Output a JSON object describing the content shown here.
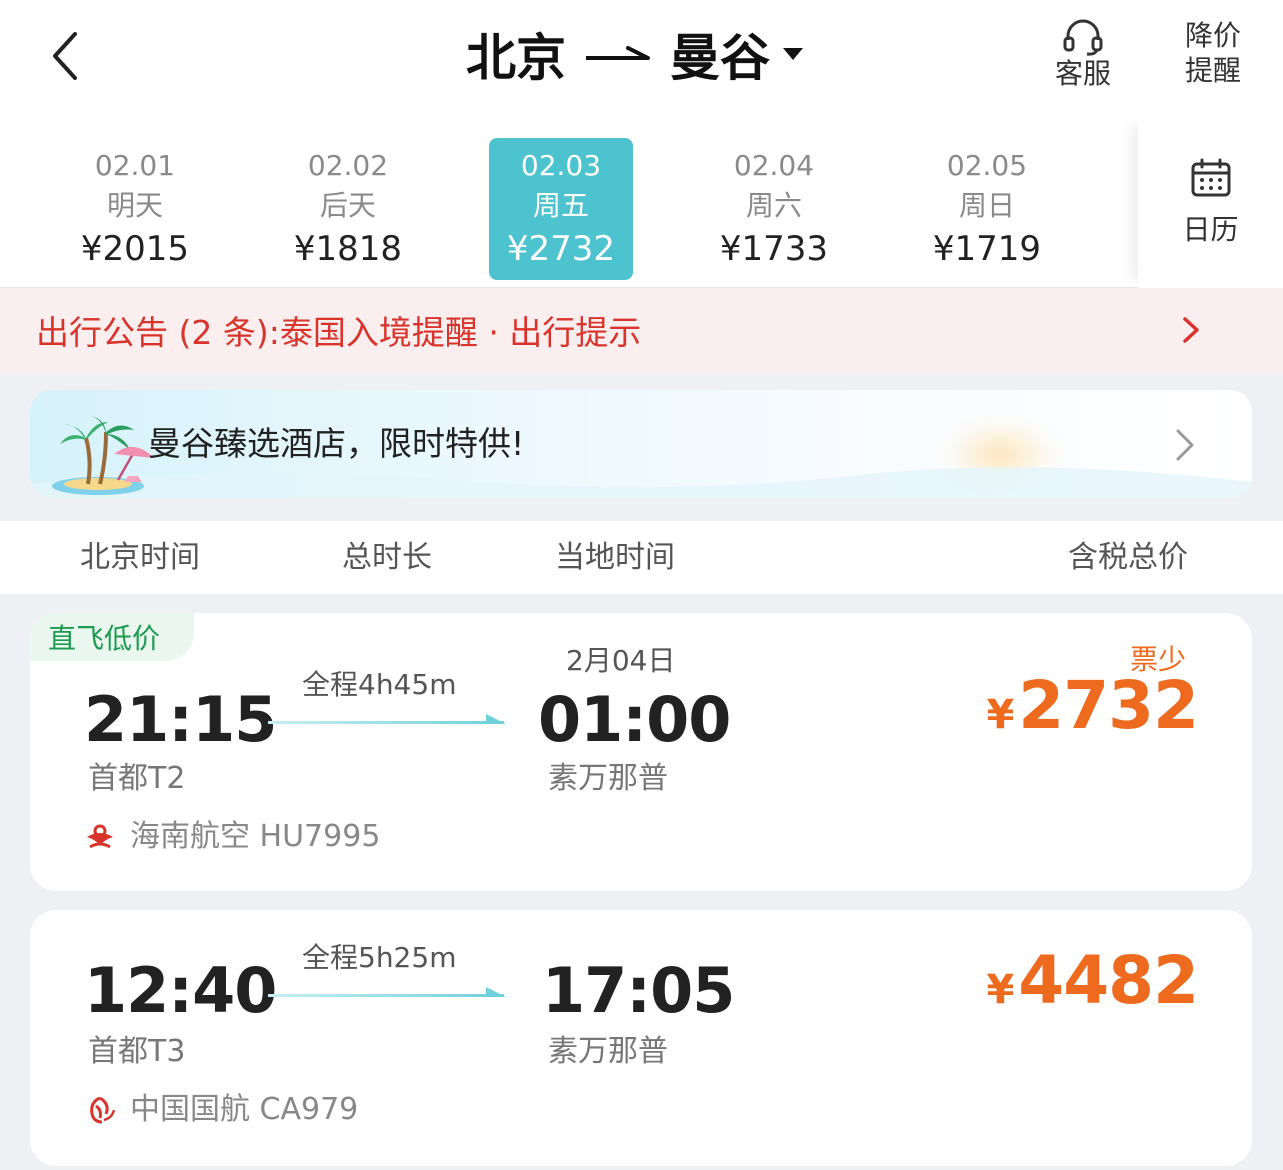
{
  "header": {
    "origin": "北京",
    "destination": "曼谷",
    "service_label": "客服",
    "price_alert_label_1": "降价",
    "price_alert_label_2": "提醒"
  },
  "dates": [
    {
      "date": "02.01",
      "weekday": "明天",
      "price": "¥2015",
      "selected": false
    },
    {
      "date": "02.02",
      "weekday": "后天",
      "price": "¥1818",
      "selected": false
    },
    {
      "date": "02.03",
      "weekday": "周五",
      "price": "¥2732",
      "selected": true
    },
    {
      "date": "02.04",
      "weekday": "周六",
      "price": "¥1733",
      "selected": false
    },
    {
      "date": "02.05",
      "weekday": "周日",
      "price": "¥1719",
      "selected": false
    }
  ],
  "calendar_label": "日历",
  "notice": {
    "text": "出行公告 (2 条):泰国入境提醒 · 出行提示"
  },
  "hotel_banner": {
    "text": "曼谷臻选酒店，限时特供!"
  },
  "columns": {
    "departure": "北京时间",
    "duration": "总时长",
    "arrival": "当地时间",
    "price": "含税总价"
  },
  "flights": [
    {
      "tag": "直飞低价",
      "dep_time": "21:15",
      "dep_airport": "首都T2",
      "duration": "全程4h45m",
      "arr_date": "2月04日",
      "arr_time": "01:00",
      "arr_airport": "素万那普",
      "airline": "海南航空 HU7995",
      "currency": "¥",
      "price": "2732",
      "stock": "票少"
    },
    {
      "tag": "",
      "dep_time": "12:40",
      "dep_airport": "首都T3",
      "duration": "全程5h25m",
      "arr_date": "",
      "arr_time": "17:05",
      "arr_airport": "素万那普",
      "airline": "中国国航 CA979",
      "currency": "¥",
      "price": "4482",
      "stock": ""
    }
  ],
  "icons": {
    "back": "chevron-left-icon",
    "route_arrow": "route-arrow-icon",
    "dropdown": "caret-down-icon",
    "service": "headset-icon",
    "calendar": "calendar-icon",
    "notice_more": "chevron-right-icon",
    "hotel_illustration": "palm-beach-icon",
    "hainan_logo": "hainan-airlines-logo",
    "airchina_logo": "air-china-logo"
  },
  "colors": {
    "accent": "#4dc3cf",
    "notice_red": "#d8342b",
    "price_orange": "#ee6a1f",
    "tag_green": "#1d9b50"
  }
}
